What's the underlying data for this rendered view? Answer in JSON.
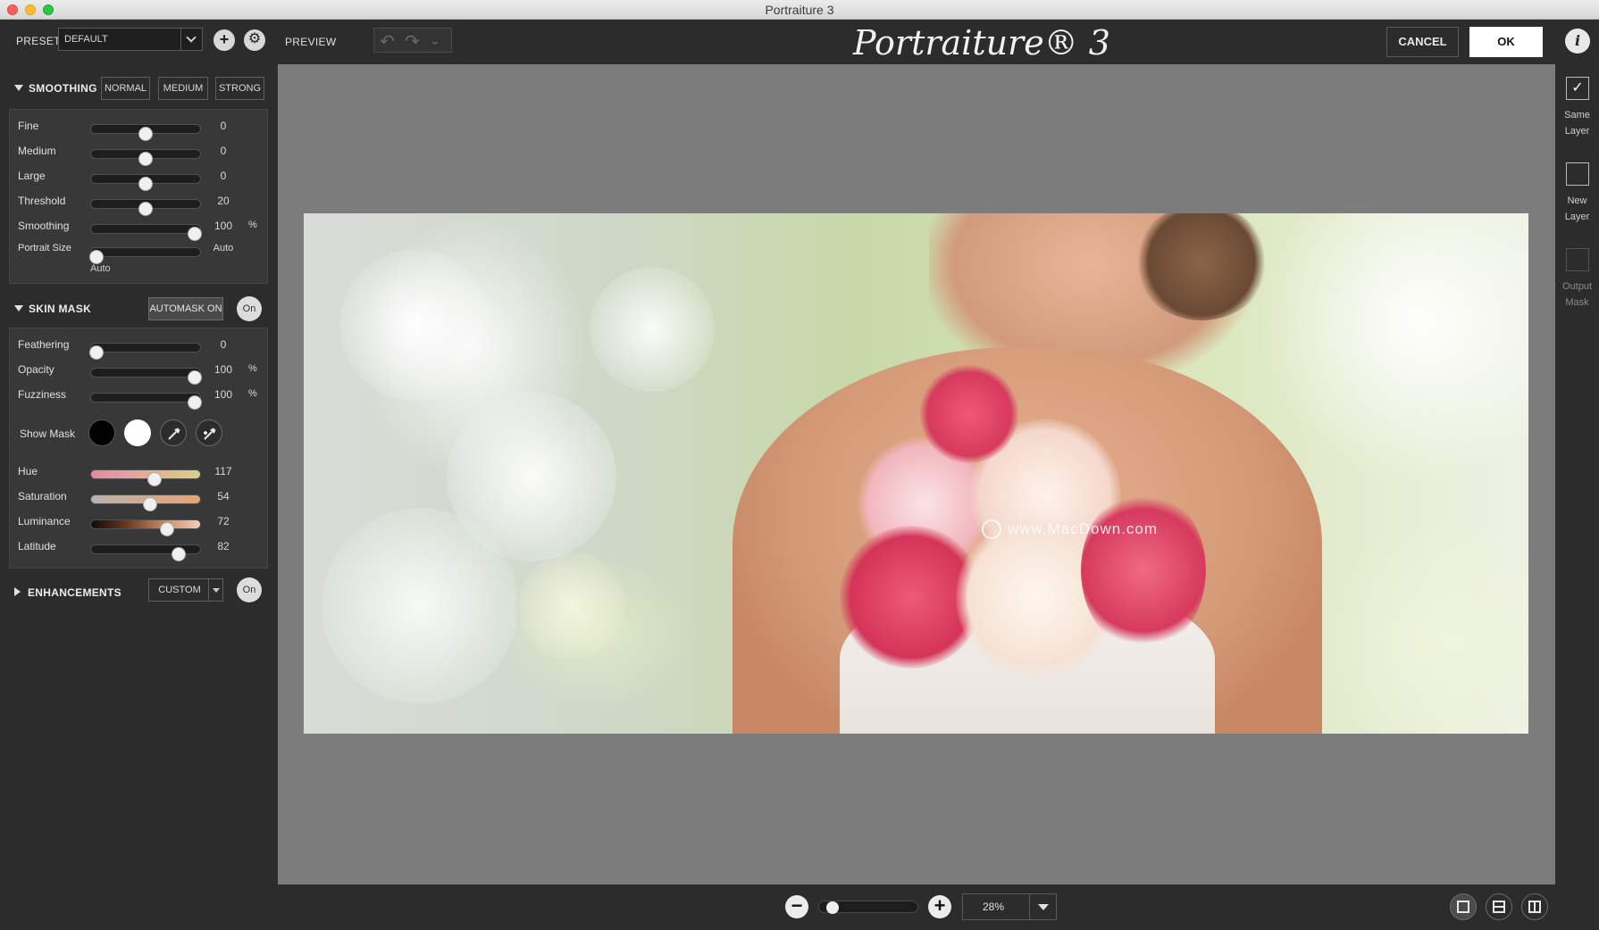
{
  "window": {
    "title": "Portraiture 3"
  },
  "toolbar": {
    "preset_label": "PRESET",
    "preset_value": "DEFAULT",
    "add_symbol": "+",
    "preview_label": "PREVIEW",
    "logo_text": "Portraiture® 3",
    "cancel_label": "CANCEL",
    "ok_label": "OK",
    "info_symbol": "i"
  },
  "smoothing": {
    "title": "SMOOTHING",
    "modes": [
      "NORMAL",
      "MEDIUM",
      "STRONG"
    ],
    "sliders": [
      {
        "label": "Fine",
        "value": "0",
        "unit": "",
        "position": 0.5
      },
      {
        "label": "Medium",
        "value": "0",
        "unit": "",
        "position": 0.5
      },
      {
        "label": "Large",
        "value": "0",
        "unit": "",
        "position": 0.5
      },
      {
        "label": "Threshold",
        "value": "20",
        "unit": "",
        "position": 0.5
      },
      {
        "label": "Smoothing",
        "value": "100",
        "unit": "%",
        "position": 0.95
      },
      {
        "label": "Portrait Size",
        "value": "Auto",
        "unit": "",
        "position": 0.05
      }
    ],
    "portrait_size_note": "Auto"
  },
  "skin_mask": {
    "title": "SKIN MASK",
    "automask_label": "AUTOMASK ON",
    "on_label": "On",
    "sliders": [
      {
        "label": "Feathering",
        "value": "0",
        "unit": "",
        "position": 0.05
      },
      {
        "label": "Opacity",
        "value": "100",
        "unit": "%",
        "position": 0.95
      },
      {
        "label": "Fuzziness",
        "value": "100",
        "unit": "%",
        "position": 0.95
      }
    ],
    "show_mask_label": "Show Mask",
    "color_sliders": [
      {
        "label": "Hue",
        "value": "117",
        "position": 0.58,
        "gradient": "linear-gradient(90deg,#e58aa4,#e8a0a0,#e0b98a,#d8cf8e)"
      },
      {
        "label": "Saturation",
        "value": "54",
        "position": 0.54,
        "gradient": "linear-gradient(90deg,#b8b2ae,#d4a98e,#e8a46e)"
      },
      {
        "label": "Luminance",
        "value": "72",
        "position": 0.7,
        "gradient": "linear-gradient(90deg,#120a06,#6a3a22,#c88a62,#eed0bc)"
      },
      {
        "label": "Latitude",
        "value": "82",
        "position": 0.8,
        "gradient": "#1e1e1e"
      }
    ]
  },
  "enhancements": {
    "title": "ENHANCEMENTS",
    "preset_value": "CUSTOM",
    "on_label": "On"
  },
  "canvas": {
    "watermark": "www.MacDown.com"
  },
  "output": {
    "items": [
      {
        "label_line1": "Same",
        "label_line2": "Layer",
        "checked": true
      },
      {
        "label_line1": "New",
        "label_line2": "Layer",
        "checked": false
      },
      {
        "label_line1": "Output",
        "label_line2": "Mask",
        "checked": false
      }
    ]
  },
  "zoom": {
    "minus_symbol": "−",
    "plus_symbol": "+",
    "value": "28%",
    "slider_position": 0.08
  },
  "colors": {
    "panel_bg": "#2c2c2c",
    "canvas_bg": "#7c7c7c",
    "accent_white": "#ffffff"
  }
}
